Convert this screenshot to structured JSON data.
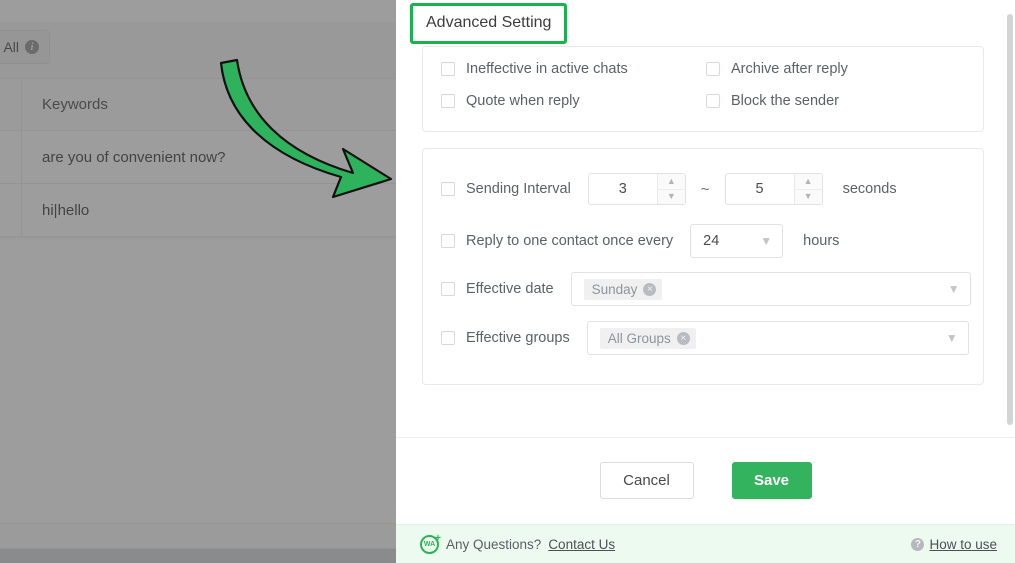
{
  "backdrop": {
    "tab_label": "All",
    "tab_info_icon": "info-icon",
    "table": {
      "header": "Keywords",
      "rows": [
        "are you of convenient now?",
        "hi|hello"
      ]
    },
    "annotation": {
      "type": "curved-arrow",
      "color": "#2eb35c",
      "direction": "down-right"
    }
  },
  "dialog": {
    "title": "Advanced Setting",
    "title_highlight_color": "#1bb14e",
    "toggles": [
      {
        "label": "Ineffective in active chats",
        "checked": false
      },
      {
        "label": "Archive after reply",
        "checked": false
      },
      {
        "label": "Quote when reply",
        "checked": false
      },
      {
        "label": "Block the sender",
        "checked": false
      }
    ],
    "settings": {
      "interval": {
        "label": "Sending Interval",
        "checked": false,
        "min_value": "3",
        "max_value": "5",
        "separator": "~",
        "unit": "seconds",
        "stepper_up_icon": "chevron-up-icon",
        "stepper_down_icon": "chevron-down-icon"
      },
      "reply_once": {
        "label": "Reply to one contact once every",
        "checked": false,
        "value": "24",
        "unit": "hours",
        "chevron_icon": "chevron-down-icon"
      },
      "effective_date": {
        "label": "Effective date",
        "checked": false,
        "tags": [
          "Sunday"
        ],
        "tag_close_icon": "close-circle-icon",
        "chevron_icon": "chevron-down-icon"
      },
      "effective_groups": {
        "label": "Effective groups",
        "checked": false,
        "tags": [
          "All Groups"
        ],
        "tag_close_icon": "close-circle-icon",
        "chevron_icon": "chevron-down-icon"
      }
    },
    "footer": {
      "cancel_label": "Cancel",
      "save_label": "Save",
      "save_color": "#33b35e"
    },
    "help_bar": {
      "logo_text": "WA",
      "question_text": "Any Questions?",
      "contact_link": "Contact Us",
      "how_to_use_link": "How to use",
      "question_icon": "question-circle-icon"
    },
    "scrollbar": {
      "visible": true
    }
  }
}
